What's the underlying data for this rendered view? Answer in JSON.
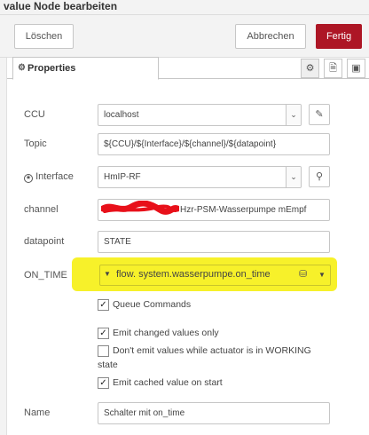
{
  "window": {
    "title": "value Node bearbeiten"
  },
  "toolbar": {
    "delete_label": "Löschen",
    "cancel_label": "Abbrechen",
    "done_label": "Fertig"
  },
  "tabs": {
    "properties_label": "Properties",
    "properties_icon": "gear-icon",
    "icons": [
      "gear-icon",
      "document-icon",
      "frame-icon"
    ]
  },
  "form": {
    "ccu": {
      "label": "CCU",
      "value": "localhost"
    },
    "topic": {
      "label": "Topic",
      "value": "${CCU}/${Interface}/${channel}/${datapoint}"
    },
    "interface": {
      "label": "Interface",
      "value": "HmIP-RF"
    },
    "channel": {
      "label": "channel",
      "value": "Hzr-PSM-Wasserpumpe mEmpf"
    },
    "datapoint": {
      "label": "datapoint",
      "value": "STATE"
    },
    "on_time": {
      "label": "ON_TIME",
      "value": "flow. system.wasserpumpe.on_time"
    },
    "queue_commands": {
      "label": "Queue Commands",
      "checked": true
    },
    "emit_changed": {
      "label": "Emit changed values only",
      "checked": true
    },
    "dont_emit_working": {
      "label_line1": "Don't emit values while actuator is in WORKING",
      "label_line2": "state",
      "checked": false
    },
    "emit_cached": {
      "label": "Emit cached value on start",
      "checked": true
    },
    "name": {
      "label": "Name",
      "value": "Schalter mit on_time"
    }
  },
  "colors": {
    "accent": "#ad1625",
    "highlight": "#f7f12a",
    "redaction": "#e8101a"
  }
}
